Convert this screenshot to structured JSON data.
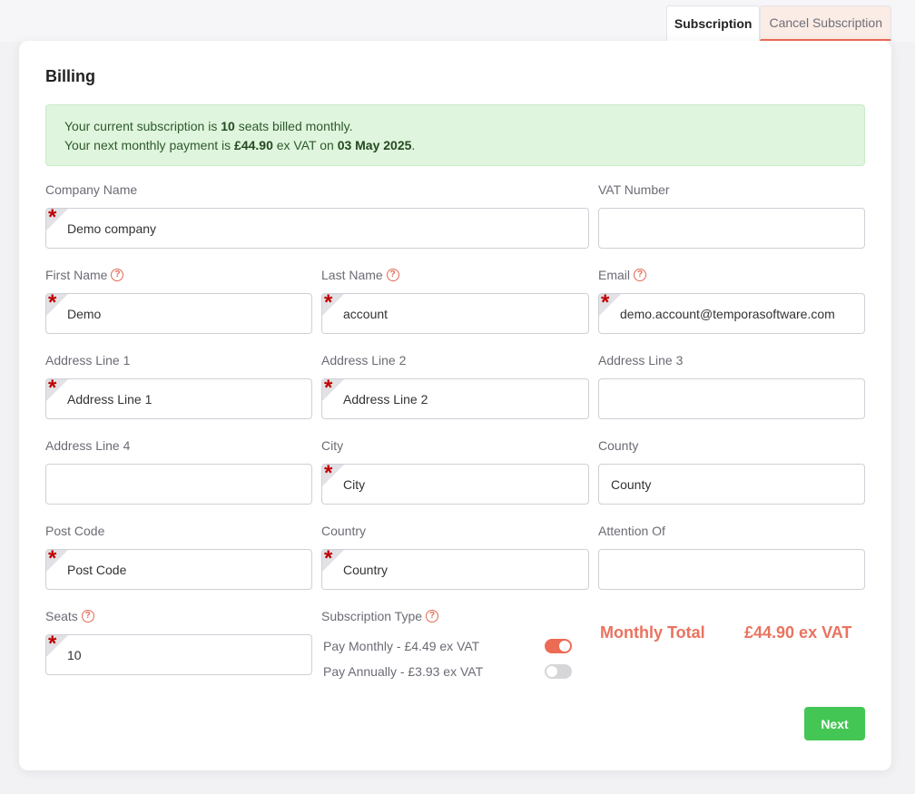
{
  "tabs": {
    "subscription": "Subscription",
    "cancel": "Cancel Subscription"
  },
  "card": {
    "title": "Billing"
  },
  "alert": {
    "line1_prefix": "Your current subscription is ",
    "seats": "10",
    "line1_suffix": " seats billed monthly.",
    "line2_prefix": "Your next monthly payment is ",
    "amount": "£44.90",
    "line2_mid": " ex VAT on ",
    "date": "03 May 2025",
    "line2_suffix": "."
  },
  "fields": {
    "company_name": {
      "label": "Company Name",
      "value": "Demo company"
    },
    "vat_number": {
      "label": "VAT Number",
      "value": ""
    },
    "first_name": {
      "label": "First Name",
      "value": "Demo"
    },
    "last_name": {
      "label": "Last Name",
      "value": "account"
    },
    "email": {
      "label": "Email",
      "value": "demo.account@temporasoftware.com"
    },
    "address1": {
      "label": "Address Line 1",
      "value": "Address Line 1"
    },
    "address2": {
      "label": "Address Line 2",
      "value": "Address Line 2"
    },
    "address3": {
      "label": "Address Line 3",
      "value": ""
    },
    "address4": {
      "label": "Address Line 4",
      "value": ""
    },
    "city": {
      "label": "City",
      "value": "City"
    },
    "county": {
      "label": "County",
      "value": "County"
    },
    "post_code": {
      "label": "Post Code",
      "value": "Post Code"
    },
    "country": {
      "label": "Country",
      "value": "Country"
    },
    "attention_of": {
      "label": "Attention Of",
      "value": ""
    },
    "seats": {
      "label": "Seats",
      "value": "10"
    }
  },
  "subscription_type": {
    "label": "Subscription Type",
    "monthly": {
      "label": "Pay Monthly - £4.49 ex VAT",
      "enabled": true
    },
    "annually": {
      "label": "Pay Annually - £3.93 ex VAT",
      "enabled": false
    }
  },
  "total": {
    "label": "Monthly Total",
    "value": "£44.90 ex VAT"
  },
  "buttons": {
    "next": "Next"
  },
  "icons": {
    "help": "question-circle-icon",
    "required": "required-asterisk-icon"
  },
  "colors": {
    "accent": "#ec6b55",
    "success": "#44c654",
    "alert_bg": "#dff5dd",
    "required": "#c00000"
  }
}
